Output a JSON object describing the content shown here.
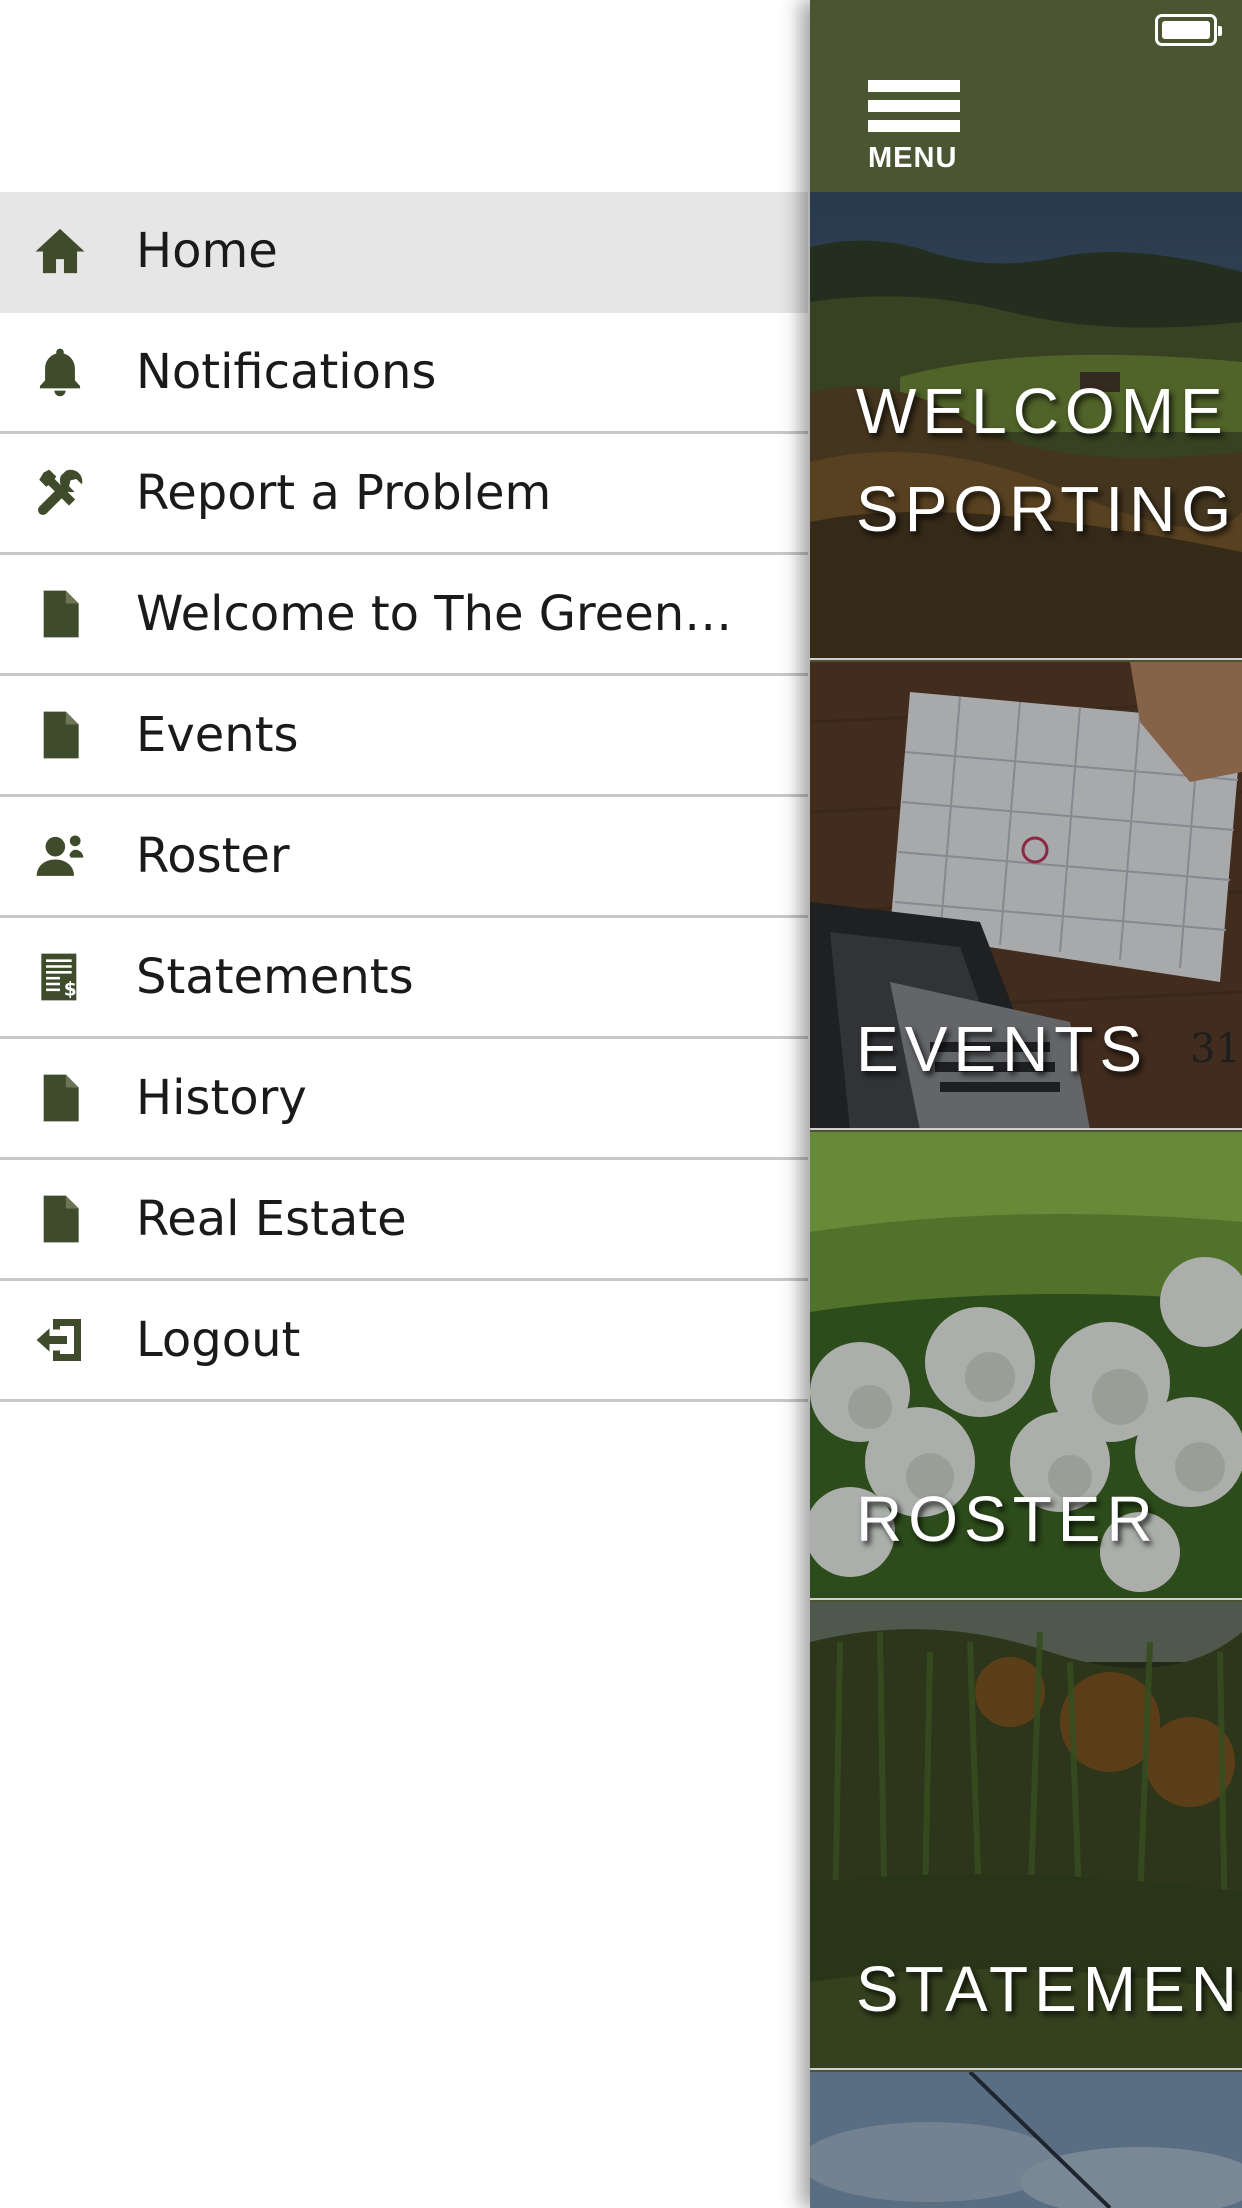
{
  "drawer": {
    "items": [
      {
        "label": "Home",
        "icon": "home-icon",
        "active": true
      },
      {
        "label": "Notifications",
        "icon": "bell-icon"
      },
      {
        "label": "Report a Problem",
        "icon": "tools-icon"
      },
      {
        "label": "Welcome to The Green…",
        "icon": "document-icon"
      },
      {
        "label": "Events",
        "icon": "document-icon"
      },
      {
        "label": "Roster",
        "icon": "person-icon"
      },
      {
        "label": "Statements",
        "icon": "statement-icon"
      },
      {
        "label": "History",
        "icon": "document-icon"
      },
      {
        "label": "Real Estate",
        "icon": "document-icon"
      },
      {
        "label": "Logout",
        "icon": "logout-icon"
      }
    ]
  },
  "header": {
    "menu_label": "MENU"
  },
  "tiles": [
    {
      "line1": "WELCOME",
      "line2": "SPORTING"
    },
    {
      "line1": "EVENTS"
    },
    {
      "line1": "ROSTER"
    },
    {
      "line1": "STATEMEN"
    }
  ],
  "colors": {
    "brand_green": "#4b5532",
    "icon_green": "#3f4c2c",
    "active_row": "#e6e6e6",
    "divider": "#c8c8c8"
  }
}
